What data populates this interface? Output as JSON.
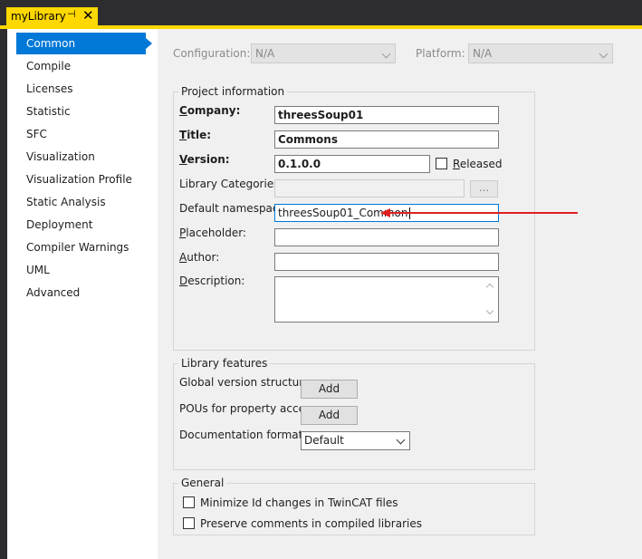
{
  "tab": {
    "title": "myLibrary",
    "pin_glyph": "⊣",
    "close_glyph": "✕"
  },
  "sidebar": {
    "items": [
      {
        "label": "Common"
      },
      {
        "label": "Compile"
      },
      {
        "label": "Licenses"
      },
      {
        "label": "Statistic"
      },
      {
        "label": "SFC"
      },
      {
        "label": "Visualization"
      },
      {
        "label": "Visualization Profile"
      },
      {
        "label": "Static Analysis"
      },
      {
        "label": "Deployment"
      },
      {
        "label": "Compiler Warnings"
      },
      {
        "label": "UML"
      },
      {
        "label": "Advanced"
      }
    ],
    "selected": "Common"
  },
  "config": {
    "configuration_label": "Configuration:",
    "configuration_value": "N/A",
    "platform_label": "Platform:",
    "platform_value": "N/A"
  },
  "project_info": {
    "title": "Project information",
    "company": {
      "label_first": "C",
      "label_rest": "ompany:",
      "value": "threesSoup01"
    },
    "title_field": {
      "label_first": "T",
      "label_rest": "itle:",
      "value": "Commons"
    },
    "version": {
      "label_first": "V",
      "label_rest": "ersion:",
      "value": "0.1.0.0"
    },
    "released": {
      "label_first": "R",
      "label_rest": "eleased",
      "checked": false
    },
    "library_categories": {
      "label": "Library Categories:",
      "value": "",
      "browse_label": "..."
    },
    "default_namespace": {
      "label": "Default namespace:",
      "value": "threesSoup01_Common"
    },
    "placeholder": {
      "label_first": "P",
      "label_rest": "laceholder:",
      "value": ""
    },
    "author": {
      "label_first": "A",
      "label_rest": "uthor:",
      "value": ""
    },
    "description": {
      "label_first": "D",
      "label_rest": "escription:",
      "value": ""
    }
  },
  "library_features": {
    "title": "Library features",
    "global_version": {
      "label": "Global version structure:",
      "button": "Add"
    },
    "pous_property": {
      "label": "POUs for property access:",
      "button": "Add"
    },
    "doc_format": {
      "label": "Documentation format:",
      "value": "Default"
    }
  },
  "general": {
    "title": "General",
    "minimize_id": {
      "label": "Minimize Id changes in TwinCAT files",
      "checked": false
    },
    "preserve_comments": {
      "label": "Preserve comments in compiled libraries",
      "checked": false
    }
  },
  "colors": {
    "accent": "#0078d7",
    "tab_highlight": "#ffd800",
    "annotation_arrow": "#e02020"
  }
}
